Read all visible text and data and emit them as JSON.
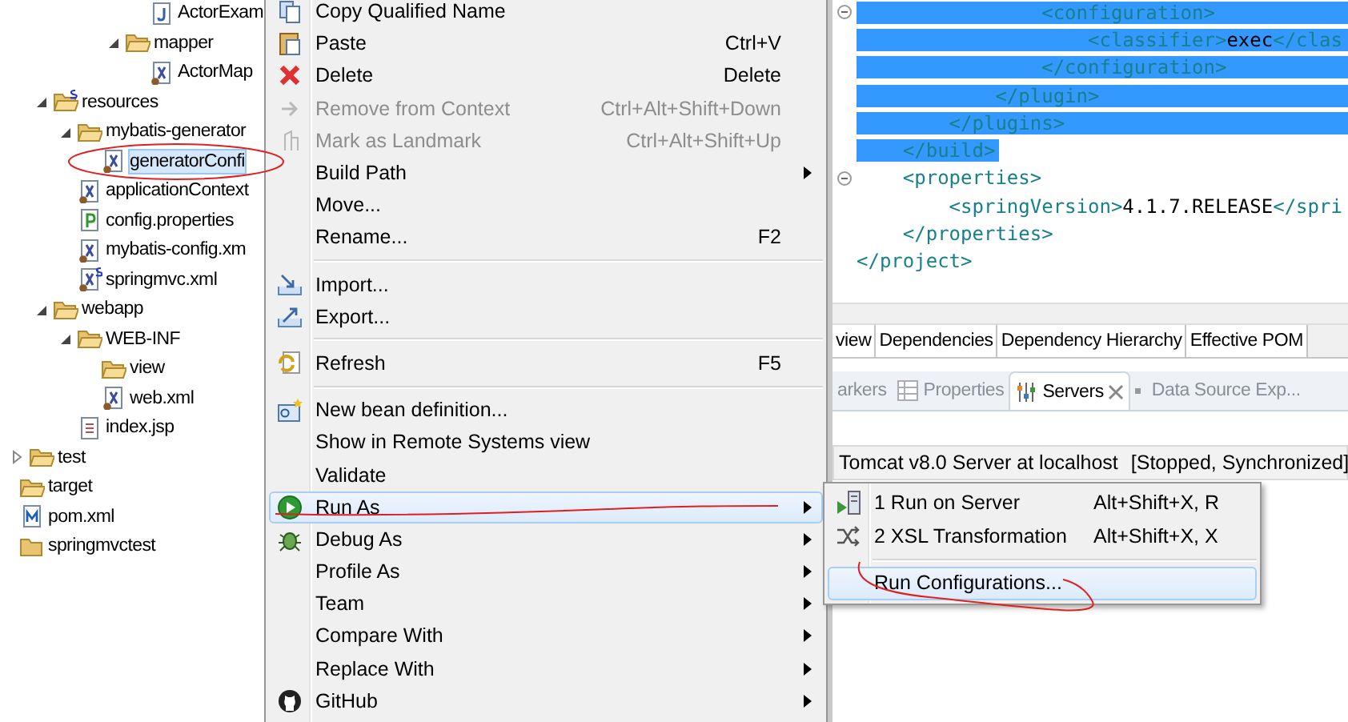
{
  "project_explorer": {
    "items": [
      {
        "children": [
          {
            "children": [
              {
                "children": [
                  {
                    "children": [
                      {
                        "children": [
                          {
                            "children": [
                              {
                                "label": "ActorExam",
                                "kind": "java",
                                "selected": false
                              }
                            ]
                          },
                          {
                            "label": "mapper",
                            "kind": "folder",
                            "expanded": true,
                            "selected": false,
                            "children": [
                              {
                                "label": "ActorMap",
                                "kind": "xml",
                                "selected": false
                              }
                            ]
                          }
                        ]
                      }
                    ]
                  }
                ]
              },
              {
                "label": "resources",
                "kind": "source-folder",
                "expanded": true,
                "selected": false,
                "children": [
                  {
                    "label": "mybatis-generator",
                    "kind": "folder",
                    "expanded": true,
                    "selected": false,
                    "children": [
                      {
                        "label": "generatorConfi",
                        "kind": "xml",
                        "selected": true
                      }
                    ]
                  },
                  {
                    "label": "applicationContext",
                    "kind": "xml",
                    "selected": false
                  },
                  {
                    "label": "config.properties",
                    "kind": "properties",
                    "selected": false
                  },
                  {
                    "label": "mybatis-config.xm",
                    "kind": "xml",
                    "selected": false
                  },
                  {
                    "label": "springmvc.xml",
                    "kind": "spring-xml",
                    "selected": false
                  }
                ]
              },
              {
                "label": "webapp",
                "kind": "folder",
                "expanded": true,
                "selected": false,
                "children": [
                  {
                    "label": "WEB-INF",
                    "kind": "folder",
                    "expanded": true,
                    "selected": false,
                    "children": [
                      {
                        "label": "view",
                        "kind": "folder",
                        "selected": false
                      },
                      {
                        "label": "web.xml",
                        "kind": "xml",
                        "selected": false
                      }
                    ]
                  },
                  {
                    "label": "index.jsp",
                    "kind": "jsp",
                    "selected": false
                  }
                ]
              }
            ]
          },
          {
            "label": "test",
            "kind": "folder",
            "expanded": false,
            "selected": false
          }
        ]
      },
      {
        "label": "target",
        "kind": "folder",
        "selected": false
      },
      {
        "label": "pom.xml",
        "kind": "maven",
        "selected": false
      },
      {
        "label": "springmvctest",
        "kind": "project",
        "selected": false
      }
    ]
  },
  "context_menu": {
    "items": [
      {
        "kind": "copy",
        "label": "Copy Qualified Name",
        "disabled": false,
        "submenu": false,
        "selected": false
      },
      {
        "kind": "paste",
        "label": "Paste",
        "shortcut": "Ctrl+V",
        "disabled": false,
        "submenu": false,
        "selected": false
      },
      {
        "kind": "delete",
        "label": "Delete",
        "shortcut": "Delete",
        "disabled": false,
        "submenu": false,
        "selected": false
      },
      {
        "kind": "remove",
        "label": "Remove from Context",
        "shortcut": "Ctrl+Alt+Shift+Down",
        "disabled": true,
        "submenu": false,
        "selected": false
      },
      {
        "kind": "landmark",
        "label": "Mark as Landmark",
        "shortcut": "Ctrl+Alt+Shift+Up",
        "disabled": true,
        "submenu": false,
        "selected": false
      },
      {
        "kind": "plain",
        "label": "Build Path",
        "disabled": false,
        "submenu": true,
        "selected": false
      },
      {
        "kind": "plain",
        "label": "Move...",
        "disabled": false,
        "submenu": false,
        "selected": false
      },
      {
        "kind": "plain",
        "label": "Rename...",
        "shortcut": "F2",
        "disabled": false,
        "submenu": false,
        "selected": false
      },
      {
        "kind": "separator"
      },
      {
        "kind": "import",
        "label": "Import...",
        "disabled": false,
        "submenu": false,
        "selected": false
      },
      {
        "kind": "export",
        "label": "Export...",
        "disabled": false,
        "submenu": false,
        "selected": false
      },
      {
        "kind": "separator"
      },
      {
        "kind": "refresh",
        "label": "Refresh",
        "shortcut": "F5",
        "disabled": false,
        "submenu": false,
        "selected": false
      },
      {
        "kind": "separator"
      },
      {
        "kind": "bean",
        "label": "New bean definition...",
        "disabled": false,
        "submenu": false,
        "selected": false
      },
      {
        "kind": "plain",
        "label": "Show in Remote Systems view",
        "disabled": false,
        "submenu": false,
        "selected": false
      },
      {
        "kind": "plain",
        "label": "Validate",
        "disabled": false,
        "submenu": false,
        "selected": false
      },
      {
        "kind": "run",
        "label": "Run As",
        "disabled": false,
        "submenu": true,
        "selected": true
      },
      {
        "kind": "debug",
        "label": "Debug As",
        "disabled": false,
        "submenu": true,
        "selected": false
      },
      {
        "kind": "plain",
        "label": "Profile As",
        "disabled": false,
        "submenu": true,
        "selected": false
      },
      {
        "kind": "plain",
        "label": "Team",
        "disabled": false,
        "submenu": true,
        "selected": false
      },
      {
        "kind": "plain",
        "label": "Compare With",
        "disabled": false,
        "submenu": true,
        "selected": false
      },
      {
        "kind": "plain",
        "label": "Replace With",
        "disabled": false,
        "submenu": true,
        "selected": false
      },
      {
        "kind": "github",
        "label": "GitHub",
        "disabled": false,
        "submenu": true,
        "selected": false
      }
    ]
  },
  "run_as_submenu": {
    "items": [
      {
        "kind": "server",
        "label": "1 Run on Server",
        "shortcut": "Alt+Shift+X, R",
        "selected": false
      },
      {
        "kind": "xsl",
        "label": "2 XSL Transformation",
        "shortcut": "Alt+Shift+X, X",
        "selected": false
      },
      {
        "kind": "separator"
      },
      {
        "kind": "plain",
        "label": "Run Configurations...",
        "selected": true
      }
    ]
  },
  "editor": {
    "lines": [
      {
        "text": "                <configuration>",
        "selected": true,
        "fold": true
      },
      {
        "text": "                    <classifier>exec</clas",
        "selected": true,
        "fold": false
      },
      {
        "text": "                </configuration>",
        "selected": true,
        "fold": false
      },
      {
        "text": "            </plugin>",
        "selected": true,
        "fold": false
      },
      {
        "text": "        </plugins>",
        "selected": true,
        "fold": false
      },
      {
        "text": "    </build>",
        "selected": true,
        "fold": false
      },
      {
        "text": "    <properties>",
        "selected": false,
        "fold": true
      },
      {
        "text": "        <springVersion>4.1.7.RELEASE</spri",
        "selected": false,
        "fold": false
      },
      {
        "text": "    </properties>",
        "selected": false,
        "fold": false
      },
      {
        "text": "</project>",
        "selected": false,
        "fold": false
      }
    ],
    "tabs": [
      {
        "label": "view",
        "selected": false
      },
      {
        "label": "Dependencies",
        "selected": false
      },
      {
        "label": "Dependency Hierarchy",
        "selected": false
      },
      {
        "label": "Effective POM",
        "selected": false
      }
    ]
  },
  "bottom_panel": {
    "tabs": [
      {
        "label": "arkers",
        "kind": "plain",
        "selected": false
      },
      {
        "label": "Properties",
        "kind": "properties",
        "selected": false
      },
      {
        "label": "Servers",
        "kind": "servers",
        "selected": true
      },
      {
        "label": "Data Source Exp...",
        "kind": "datasource",
        "selected": false
      }
    ],
    "servers": [
      {
        "name": "Tomcat v8.0 Server at localhost",
        "status": "[Stopped, Synchronized]",
        "selected": true
      }
    ]
  }
}
